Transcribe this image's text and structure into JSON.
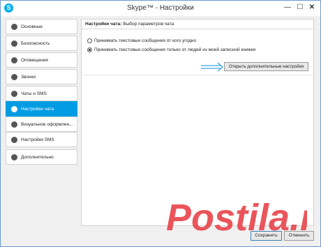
{
  "window": {
    "title": "Skype™ - Настройки",
    "icon": "skype-logo-icon",
    "controls": {
      "minimize": "—",
      "maximize": "☐",
      "close": "✕"
    }
  },
  "sidebar": {
    "items": [
      {
        "label": "Основные",
        "icon": "skype-icon"
      },
      {
        "label": "Безопасность",
        "icon": "lock-icon"
      },
      {
        "label": "Оповещения",
        "icon": "bell-icon"
      },
      {
        "label": "Звонки",
        "icon": "phone-icon"
      },
      {
        "label": "Чаты и SMS",
        "icon": "chat-icon"
      },
      {
        "label": "Настройки чата",
        "icon": "chat-bubble-icon",
        "active": true
      },
      {
        "label": "Визуальное оформлен...",
        "icon": "smiley-icon"
      },
      {
        "label": "Настройки SMS",
        "icon": "sms-icon"
      },
      {
        "label": "Дополнительно",
        "icon": "gear-icon"
      }
    ],
    "active_color": "#009ce3"
  },
  "panel": {
    "header_bold": "Настройки чата:",
    "header_rest": " Выбор параметров чата",
    "options": [
      {
        "label": "Принимать текстовые сообщения от кого угодно",
        "selected": false
      },
      {
        "label": "Принимать текстовые сообщения только от людей из моей записной книжки",
        "selected": true
      }
    ],
    "advanced_button": "Открыть дополнительные настройки"
  },
  "footer": {
    "save": "Сохранить",
    "cancel": "Отменить"
  },
  "watermark": {
    "text": "Postila.ru",
    "color": "#e8424a"
  }
}
